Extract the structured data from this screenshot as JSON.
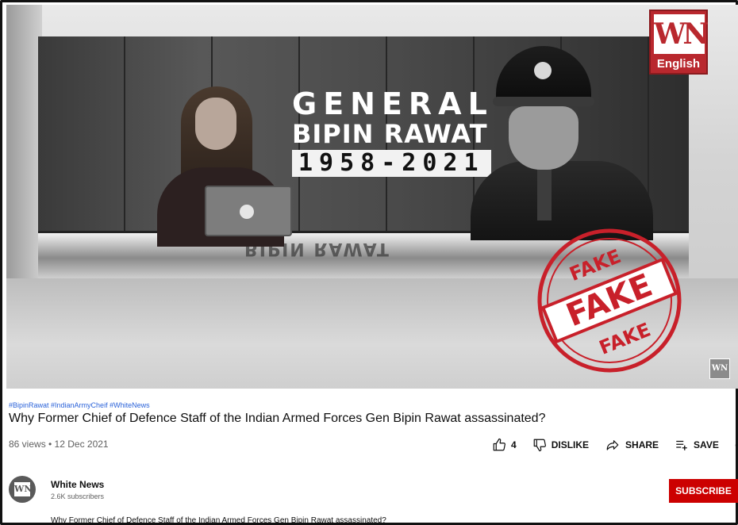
{
  "video": {
    "overlay": {
      "line1": "GENERAL",
      "line2": "BIPIN RAWAT",
      "years": "1958-2021",
      "desk_reflection": "BIPIN RAWAT"
    },
    "logo": {
      "mark": "WN",
      "language": "English"
    },
    "stamp": {
      "top": "FAKE",
      "center": "FAKE",
      "bottom": "FAKE",
      "color": "#c8202a"
    },
    "watermark": "WN"
  },
  "details": {
    "hashtags": "#BipinRawat #IndianArmyCheif #WhiteNews",
    "title": "Why Former Chief of Defence Staff of the Indian Armed Forces Gen Bipin Rawat assassinated?",
    "meta": "86 views • 12 Dec 2021"
  },
  "actions": {
    "like_count": "4",
    "dislike_label": "DISLIKE",
    "share_label": "SHARE",
    "save_label": "SAVE",
    "more_label": "···"
  },
  "channel": {
    "avatar_mark": "WN",
    "name": "White News",
    "subscribers": "2.6K subscribers",
    "subscribe_label": "SUBSCRIBE",
    "subscribe_color": "#cc0000"
  },
  "description": "Why Former Chief of Defence Staff of the Indian Armed Forces Gen Bipin Rawat assassinated?"
}
